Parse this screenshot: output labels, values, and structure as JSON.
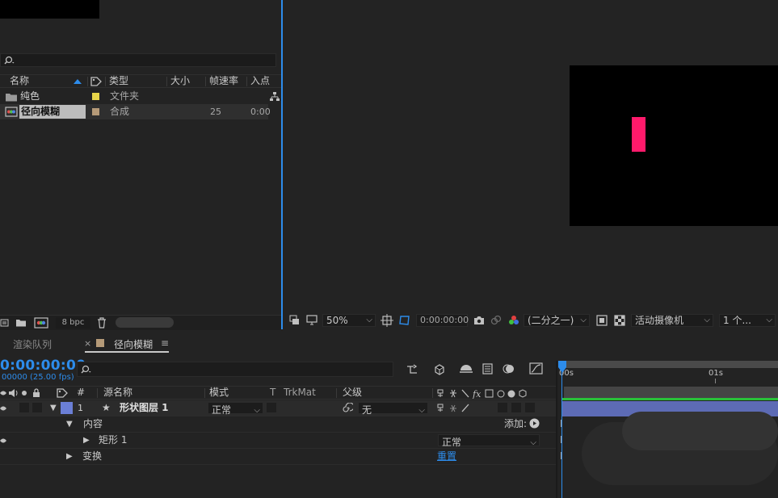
{
  "project_panel": {
    "search_placeholder": "",
    "columns": {
      "name": "名称",
      "type": "类型",
      "size": "大小",
      "fps": "帧速率",
      "in": "入点"
    },
    "items": [
      {
        "name": "纯色",
        "type": "文件夹",
        "fps": "",
        "in": "",
        "label_color": "#e8d54a",
        "icon": "folder-icon"
      },
      {
        "name": "径向模糊",
        "type": "合成",
        "fps": "25",
        "in": "0:00",
        "label_color": "#b59a78",
        "icon": "composition-icon",
        "selected": true
      }
    ],
    "bpc": "8 bpc"
  },
  "viewer": {
    "zoom": "50%",
    "timecode": "0:00:00:00",
    "resolution": "(二分之一)",
    "camera": "活动摄像机",
    "views": "1 个...",
    "shape_color": "#ff1a6b"
  },
  "timeline": {
    "tabs": {
      "render_queue": "渲染队列",
      "close": "×",
      "comp": "径向模糊",
      "menu": "≡"
    },
    "timecode": "0:00:00:00",
    "fps_line": "00000 (25.00 fps)",
    "columns": {
      "hash": "#",
      "source": "源名称",
      "mode": "模式",
      "t": "T",
      "trkmat": "TrkMat",
      "parent": "父级"
    },
    "layer": {
      "number": "1",
      "name": "形状图层 1",
      "mode": "正常",
      "parent": "无",
      "label_color": "#6b7fd6"
    },
    "contents": {
      "label": "内容",
      "add": "添加:"
    },
    "rect": {
      "label": "矩形 1",
      "mode": "正常"
    },
    "transform": {
      "label": "变换",
      "reset": "重置"
    },
    "ruler": {
      "start": "00s",
      "mark": "01s"
    }
  }
}
